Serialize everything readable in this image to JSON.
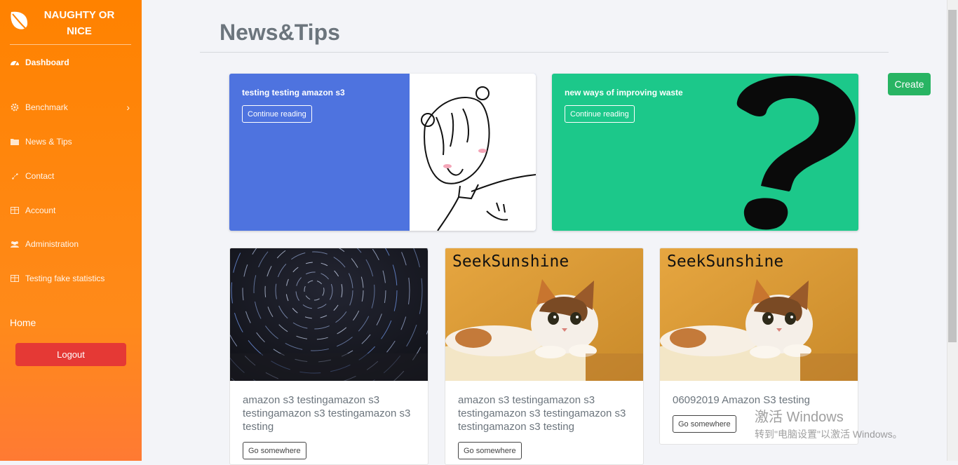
{
  "brand": {
    "name": "NAUGHTY OR NICE",
    "logo_icon": "leaf-icon"
  },
  "sidebar": {
    "items": [
      {
        "label": "Dashboard",
        "icon": "dashboard-icon",
        "active": true
      },
      {
        "label": "Benchmark",
        "icon": "gear-icon",
        "has_children": true
      },
      {
        "label": "News & Tips",
        "icon": "folder-icon"
      },
      {
        "label": "Contact",
        "icon": "phone-icon"
      },
      {
        "label": "Account",
        "icon": "table-icon"
      },
      {
        "label": "Administration",
        "icon": "users-icon"
      },
      {
        "label": "Testing fake statistics",
        "icon": "table-icon"
      }
    ],
    "home_label": "Home",
    "logout_label": "Logout"
  },
  "page": {
    "title": "News&Tips",
    "create_label": "Create"
  },
  "featured": [
    {
      "title": "testing testing amazon s3",
      "button": "Continue reading",
      "bg_color": "#4e73df"
    },
    {
      "title": "new ways of improving waste",
      "button": "Continue reading",
      "bg_color": "#1cc88a"
    }
  ],
  "cards": [
    {
      "text": "amazon s3 testingamazon s3 testingamazon s3 testingamazon s3 testing",
      "button": "Go somewhere",
      "image": "star-trails"
    },
    {
      "text": "amazon s3 testingamazon s3 testingamazon s3 testingamazon s3 testingamazon s3 testing",
      "button": "Go somewhere",
      "image": "kitten",
      "image_caption": "SeekSunshine"
    },
    {
      "text": "06092019 Amazon S3 testing",
      "button": "Go somewhere",
      "image": "kitten",
      "image_caption": "SeekSunshine"
    }
  ],
  "watermark": {
    "line1": "激活 Windows",
    "line2": "转到\"电脑设置\"以激活 Windows。"
  },
  "colors": {
    "sidebar": "#ff8200",
    "logout": "#e53935",
    "create": "#28b463"
  }
}
